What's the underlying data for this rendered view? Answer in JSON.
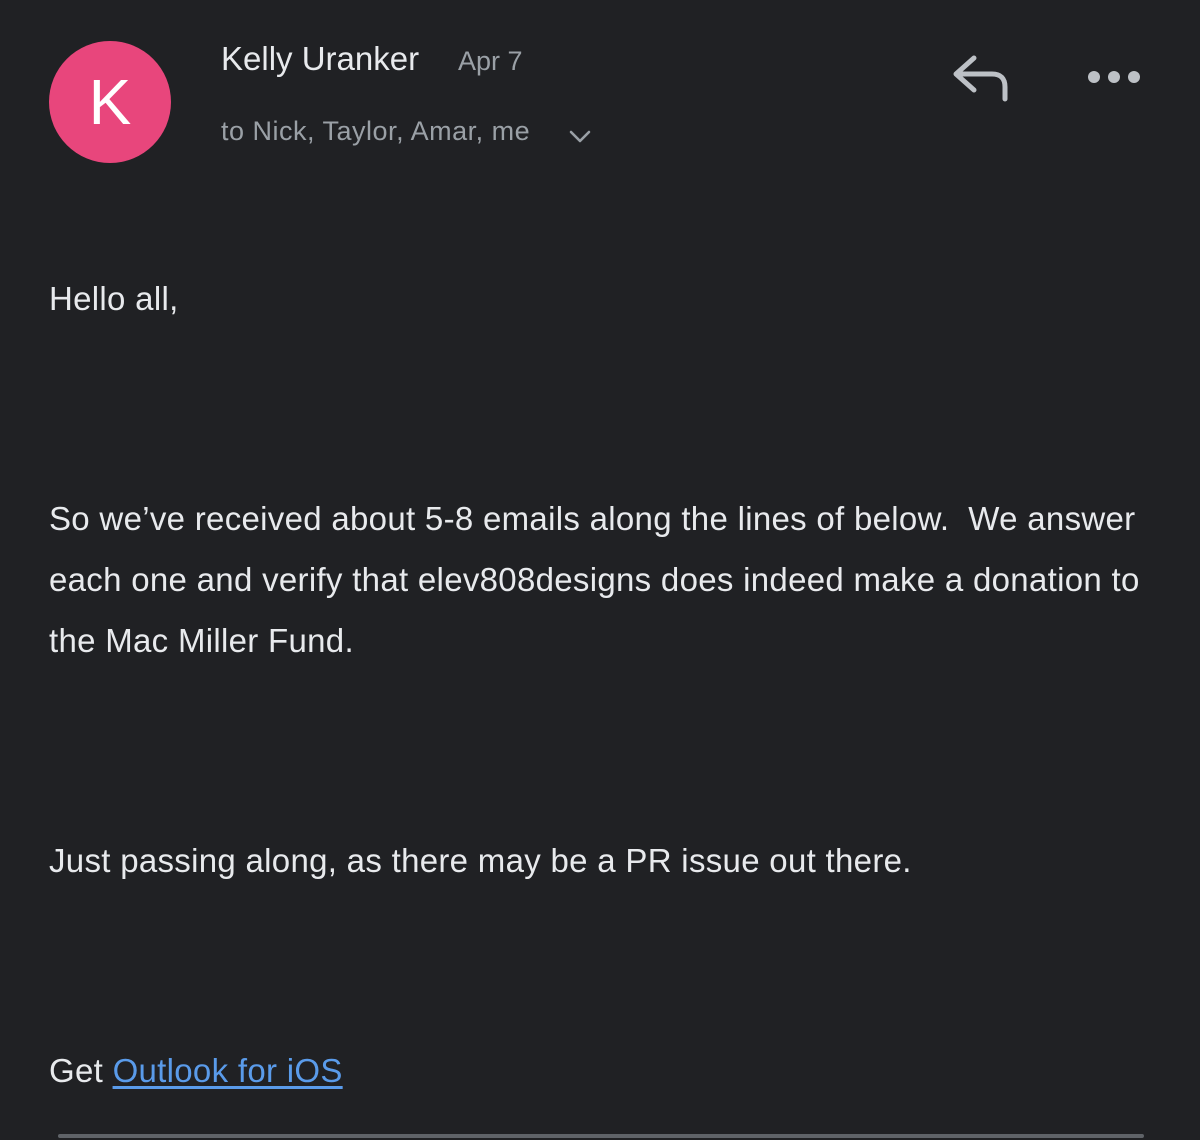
{
  "sender": {
    "initial": "K",
    "name": "Kelly Uranker",
    "date": "Apr 7",
    "recipients": "to Nick, Taylor, Amar, me",
    "avatar_color": "#e8467c"
  },
  "actions": {
    "reply_icon": "reply-icon",
    "more_icon": "more-horizontal-icon",
    "expand_icon": "chevron-down-icon"
  },
  "body": {
    "greeting": "Hello all,",
    "paragraph1": "So we’ve received about 5-8 emails along the lines of below.  We answer each one and verify that elev808designs does indeed make a donation to the Mac Miller Fund.",
    "paragraph2": "Just passing along, as there may be a PR issue out there."
  },
  "signature": {
    "prefix": "Get ",
    "link_text": "Outlook for iOS",
    "link_color": "#5a9bea"
  },
  "theme": {
    "background": "#202124",
    "text": "#e8eaed",
    "muted": "#9aa0a6"
  }
}
